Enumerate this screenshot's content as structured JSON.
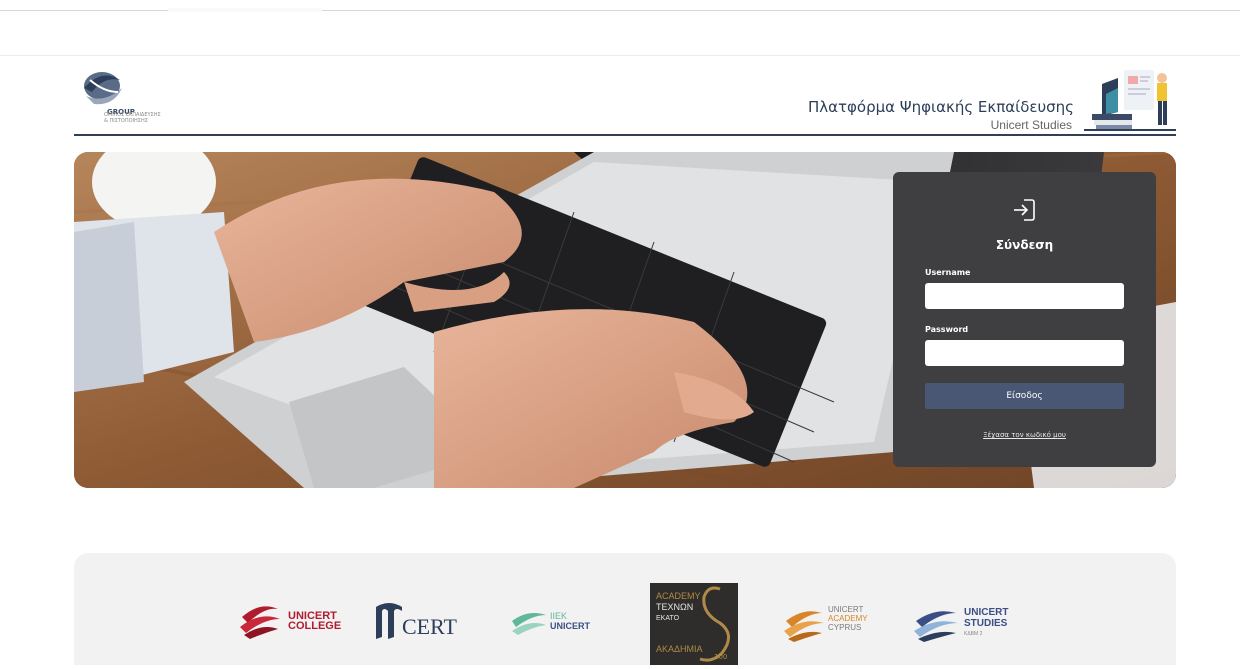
{
  "header": {
    "logo": {
      "wordmark": "GROUP",
      "subtitle_lines": [
        "ΟΜΙΛΟΣ ΕΚΠΑΙΔΕΥΣΗΣ",
        "& ΠΙΣΤΟΠΟΙΗΣΗΣ"
      ]
    },
    "title": "Πλατφόρμα Ψηφιακής Εκπαίδευσης",
    "subtitle": "Unicert Studies"
  },
  "login": {
    "icon": "login-icon",
    "title": "Σύνδεση",
    "username_label": "Username",
    "username_value": "",
    "password_label": "Password",
    "password_value": "",
    "submit_label": "Είσοδος",
    "forgot_link": "Ξέχασα τον κωδικό μου"
  },
  "partners": [
    {
      "name": "unicert-college",
      "lines": [
        "UNICERT",
        "COLLEGE"
      ]
    },
    {
      "name": "tcert",
      "lines": [
        "CERT"
      ]
    },
    {
      "name": "iiek-unicert",
      "lines": [
        "ΙΙΕΚ",
        "UNICERT"
      ]
    },
    {
      "name": "academy-technon",
      "lines": [
        "ACADEMY",
        "TEXNΩN",
        "ΕΚΑΤΟ",
        "ΑΚΑΔΗΜΙΑ",
        "100"
      ]
    },
    {
      "name": "unicert-academy-cyprus",
      "lines": [
        "UNICERT",
        "ACADEMY",
        "CYPRUS"
      ]
    },
    {
      "name": "unicert-studies",
      "lines": [
        "UNICERT",
        "STUDIES",
        "ΚΔΒΜ 2"
      ]
    }
  ],
  "colors": {
    "brand_navy": "#2d3e5a",
    "login_panel": "#3f3f41",
    "login_button": "#495775",
    "partners_bg": "#f2f2f2",
    "college_red": "#b01c2e",
    "cyprus_orange": "#d8852a",
    "studies_blue": "#3b4f86",
    "iiek_green": "#5fb89a"
  }
}
